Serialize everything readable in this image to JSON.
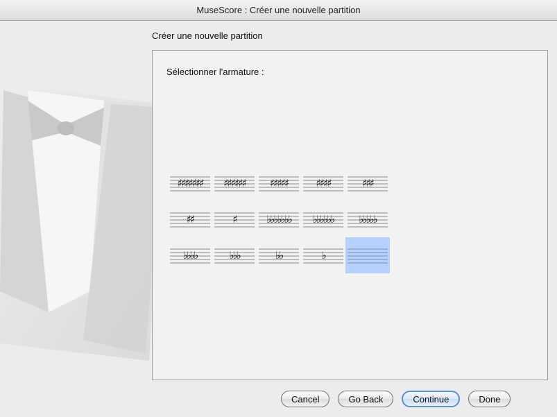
{
  "window": {
    "title": "MuseScore : Créer une nouvelle partition"
  },
  "wizard": {
    "page_title": "Créer une nouvelle partition"
  },
  "keysig": {
    "prompt": "Sélectionner l'armature :",
    "rows": [
      [
        {
          "name": "ks-7-sharps",
          "glyph": "♯♯♯♯♯♯♯",
          "selected": false
        },
        {
          "name": "ks-6-sharps",
          "glyph": "♯♯♯♯♯♯",
          "selected": false
        },
        {
          "name": "ks-5-sharps",
          "glyph": "♯♯♯♯♯",
          "selected": false
        },
        {
          "name": "ks-4-sharps",
          "glyph": "♯♯♯♯",
          "selected": false
        },
        {
          "name": "ks-3-sharps",
          "glyph": "♯♯♯",
          "selected": false
        }
      ],
      [
        {
          "name": "ks-2-sharps",
          "glyph": "♯♯",
          "selected": false
        },
        {
          "name": "ks-1-sharp",
          "glyph": "♯",
          "selected": false
        },
        {
          "name": "ks-7-flats",
          "glyph": "♭♭♭♭♭♭♭",
          "selected": false
        },
        {
          "name": "ks-6-flats",
          "glyph": "♭♭♭♭♭♭",
          "selected": false
        },
        {
          "name": "ks-5-flats",
          "glyph": "♭♭♭♭♭",
          "selected": false
        }
      ],
      [
        {
          "name": "ks-4-flats",
          "glyph": "♭♭♭♭",
          "selected": false
        },
        {
          "name": "ks-3-flats",
          "glyph": "♭♭♭",
          "selected": false
        },
        {
          "name": "ks-2-flats",
          "glyph": "♭♭",
          "selected": false
        },
        {
          "name": "ks-1-flat",
          "glyph": "♭",
          "selected": false
        },
        {
          "name": "ks-no-accidentals",
          "glyph": "",
          "selected": true
        }
      ]
    ]
  },
  "buttons": {
    "cancel": "Cancel",
    "back": "Go Back",
    "continue": "Continue",
    "done": "Done"
  },
  "colors": {
    "selection": "#b5d1ff",
    "default_button": "#5b8fd6"
  }
}
